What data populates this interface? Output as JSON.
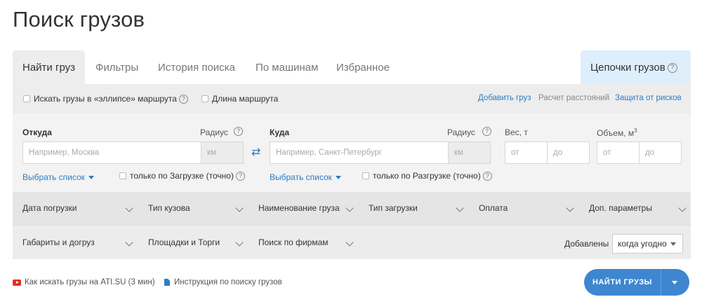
{
  "page": {
    "title": "Поиск грузов"
  },
  "tabs": [
    {
      "label": "Найти груз",
      "active": true
    },
    {
      "label": "Фильтры"
    },
    {
      "label": "История поиска"
    },
    {
      "label": "По машинам"
    },
    {
      "label": "Избранное"
    }
  ],
  "chains_tab": {
    "label": "Цепочки грузов"
  },
  "options": {
    "ellipse_label": "Искать грузы в «эллипсе» маршрута",
    "route_length_label": "Длина маршрута",
    "add_cargo": "Добавить груз",
    "distance_calc": "Расчет расстояний",
    "risk_protection": "Защита от рисков"
  },
  "from": {
    "label": "Откуда",
    "radius_label": "Радиус",
    "placeholder": "Например, Москва",
    "unit": "км",
    "choose_list": "Выбрать список",
    "exact_label": "только по Загрузке (точно)"
  },
  "to": {
    "label": "Куда",
    "radius_label": "Радиус",
    "placeholder": "Например, Санкт-Петербург",
    "unit": "км",
    "choose_list": "Выбрать список",
    "exact_label": "только по Разгрузке (точно)"
  },
  "weight": {
    "label": "Вес, т",
    "from": "от",
    "to": "до"
  },
  "volume": {
    "label": "Объем, м",
    "sup": "3",
    "from": "от",
    "to": "до"
  },
  "filters": {
    "row1": [
      "Дата погрузки",
      "Тип кузова",
      "Наименование груза",
      "Тип загрузки",
      "Оплата",
      "Доп. параметры"
    ],
    "row2": [
      "Габариты и догруз",
      "Площадки и Торги",
      "Поиск по фирмам"
    ],
    "added_label": "Добавлены",
    "added_value": "когда угодно"
  },
  "bottom": {
    "video_link": "Как искать грузы на ATI.SU (3 мин)",
    "doc_link": "Инструкция по поиску грузов",
    "find_button": "НАЙТИ ГРУЗЫ"
  },
  "colors": {
    "accent": "#3e86cf",
    "link": "#2e7bc4",
    "panel": "#ededed",
    "chains_bg": "#dfeefb"
  },
  "icons": {
    "help": "question-circle-icon",
    "swap": "swap-arrows-icon",
    "video": "youtube-icon",
    "doc": "document-icon"
  }
}
